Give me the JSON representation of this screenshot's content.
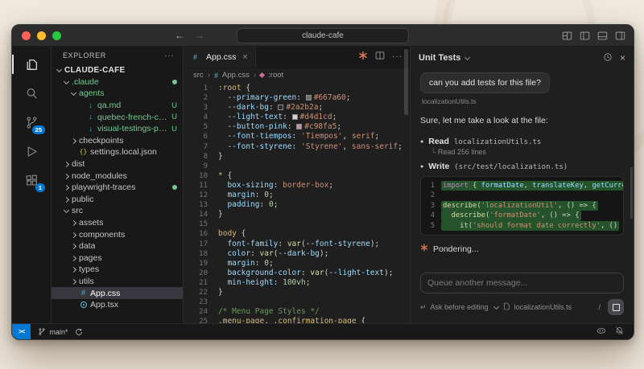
{
  "colors": {
    "badge_blue": "#0078d4",
    "git_green": "#73c991",
    "claude_orange": "#d97757",
    "remote_blue": "#0078d4",
    "diff_green": "rgba(63,185,80,0.38)"
  },
  "titlebar": {
    "search": "claude-cafe"
  },
  "activitybar": {
    "scm_badge": "25",
    "ext_badge": "1"
  },
  "explorer": {
    "title": "EXPLORER",
    "root": "CLAUDE-CAFE",
    "items": [
      {
        "label": ".claude",
        "depth": 1,
        "chev": "down",
        "dot": true,
        "color": "green"
      },
      {
        "label": "agents",
        "depth": 2,
        "chev": "down",
        "color": "green"
      },
      {
        "label": "qa.md",
        "depth": 3,
        "icon": "arrow",
        "git": "U",
        "color": "green"
      },
      {
        "label": "quebec-french-complian...",
        "depth": 3,
        "icon": "arrow",
        "git": "U",
        "color": "green"
      },
      {
        "label": "visual-testings-playwright...",
        "depth": 3,
        "icon": "arrow",
        "git": "U",
        "color": "green"
      },
      {
        "label": "checkpoints",
        "depth": 2,
        "chev": "right"
      },
      {
        "label": "settings.local.json",
        "depth": 2,
        "icon": "json"
      },
      {
        "label": "dist",
        "depth": 1,
        "chev": "right"
      },
      {
        "label": "node_modules",
        "depth": 1,
        "chev": "right"
      },
      {
        "label": "playwright-traces",
        "depth": 1,
        "chev": "right",
        "dot": true
      },
      {
        "label": "public",
        "depth": 1,
        "chev": "right"
      },
      {
        "label": "src",
        "depth": 1,
        "chev": "down"
      },
      {
        "label": "assets",
        "depth": 2,
        "chev": "right"
      },
      {
        "label": "components",
        "depth": 2,
        "chev": "right"
      },
      {
        "label": "data",
        "depth": 2,
        "chev": "right"
      },
      {
        "label": "pages",
        "depth": 2,
        "chev": "right"
      },
      {
        "label": "types",
        "depth": 2,
        "chev": "right"
      },
      {
        "label": "utils",
        "depth": 2,
        "chev": "right"
      },
      {
        "label": "App.css",
        "depth": 2,
        "icon": "css",
        "selected": true
      },
      {
        "label": "App.tsx",
        "depth": 2,
        "icon": "react"
      }
    ]
  },
  "editor": {
    "tab": "App.css",
    "breadcrumbs": [
      "src",
      "App.css",
      ":root"
    ],
    "lines": [
      [
        [
          "sel",
          ":root"
        ],
        [
          "p",
          " {"
        ]
      ],
      [
        [
          "p",
          "  "
        ],
        [
          "prop",
          "--primary-green"
        ],
        [
          "p",
          ": "
        ],
        [
          "sw",
          "#667a60"
        ],
        [
          "val",
          "#667a60"
        ],
        [
          "p",
          ";"
        ]
      ],
      [
        [
          "p",
          "  "
        ],
        [
          "prop",
          "--dark-bg"
        ],
        [
          "p",
          ": "
        ],
        [
          "sw",
          "#2a2b2a"
        ],
        [
          "val",
          "#2a2b2a"
        ],
        [
          "p",
          ";"
        ]
      ],
      [
        [
          "p",
          "  "
        ],
        [
          "prop",
          "--light-text"
        ],
        [
          "p",
          ": "
        ],
        [
          "sw",
          "#d4d1cd"
        ],
        [
          "val",
          "#d4d1cd"
        ],
        [
          "p",
          ";"
        ]
      ],
      [
        [
          "p",
          "  "
        ],
        [
          "prop",
          "--button-pink"
        ],
        [
          "p",
          ": "
        ],
        [
          "sw",
          "#c98fa5"
        ],
        [
          "val",
          "#c98fa5"
        ],
        [
          "p",
          ";"
        ]
      ],
      [
        [
          "p",
          "  "
        ],
        [
          "prop",
          "--font-tiempos"
        ],
        [
          "p",
          ": "
        ],
        [
          "str",
          "'Tiempos'"
        ],
        [
          "p",
          ", "
        ],
        [
          "val",
          "serif"
        ],
        [
          "p",
          ";"
        ]
      ],
      [
        [
          "p",
          "  "
        ],
        [
          "prop",
          "--font-styrene"
        ],
        [
          "p",
          ": "
        ],
        [
          "str",
          "'Styrene'"
        ],
        [
          "p",
          ", "
        ],
        [
          "val",
          "sans-serif"
        ],
        [
          "p",
          ";"
        ]
      ],
      [
        [
          "p",
          "}"
        ]
      ],
      [],
      [
        [
          "sel",
          "*"
        ],
        [
          "p",
          " {"
        ]
      ],
      [
        [
          "p",
          "  "
        ],
        [
          "prop",
          "box-sizing"
        ],
        [
          "p",
          ": "
        ],
        [
          "val",
          "border-box"
        ],
        [
          "p",
          ";"
        ]
      ],
      [
        [
          "p",
          "  "
        ],
        [
          "prop",
          "margin"
        ],
        [
          "p",
          ": "
        ],
        [
          "num",
          "0"
        ],
        [
          "p",
          ";"
        ]
      ],
      [
        [
          "p",
          "  "
        ],
        [
          "prop",
          "padding"
        ],
        [
          "p",
          ": "
        ],
        [
          "num",
          "0"
        ],
        [
          "p",
          ";"
        ]
      ],
      [
        [
          "p",
          "}"
        ]
      ],
      [],
      [
        [
          "sel",
          "body"
        ],
        [
          "p",
          " {"
        ]
      ],
      [
        [
          "p",
          "  "
        ],
        [
          "prop",
          "font-family"
        ],
        [
          "p",
          ": "
        ],
        [
          "fn",
          "var"
        ],
        [
          "p",
          "("
        ],
        [
          "prop",
          "--font-styrene"
        ],
        [
          "p",
          ");"
        ]
      ],
      [
        [
          "p",
          "  "
        ],
        [
          "prop",
          "color"
        ],
        [
          "p",
          ": "
        ],
        [
          "fn",
          "var"
        ],
        [
          "p",
          "("
        ],
        [
          "prop",
          "--dark-bg"
        ],
        [
          "p",
          ");"
        ]
      ],
      [
        [
          "p",
          "  "
        ],
        [
          "prop",
          "margin"
        ],
        [
          "p",
          ": "
        ],
        [
          "num",
          "0"
        ],
        [
          "p",
          ";"
        ]
      ],
      [
        [
          "p",
          "  "
        ],
        [
          "prop",
          "background-color"
        ],
        [
          "p",
          ": "
        ],
        [
          "fn",
          "var"
        ],
        [
          "p",
          "("
        ],
        [
          "prop",
          "--light-text"
        ],
        [
          "p",
          ");"
        ]
      ],
      [
        [
          "p",
          "  "
        ],
        [
          "prop",
          "min-height"
        ],
        [
          "p",
          ": "
        ],
        [
          "num",
          "100vh"
        ],
        [
          "p",
          ";"
        ]
      ],
      [
        [
          "p",
          "}"
        ]
      ],
      [],
      [
        [
          "com",
          "/* Menu Page Styles */"
        ]
      ],
      [
        [
          "sel",
          ".menu-page"
        ],
        [
          "p",
          ", "
        ],
        [
          "sel",
          ".confirmation-page"
        ],
        [
          "p",
          " {"
        ]
      ]
    ]
  },
  "chat": {
    "title": "Unit Tests",
    "user_message": "can you add tests for this file?",
    "attachment": "localizationUtils.ts",
    "intro": "Sure, let me take a look at the file:",
    "read_label": "Read",
    "read_file": "localizationUtils.ts",
    "read_detail": "Read 256 lines",
    "write_label": "Write",
    "write_file": "(src/test/localization.ts)",
    "status": "Pondering...",
    "code_lines": [
      {
        "hl": true,
        "t": [
          [
            "kw",
            "import"
          ],
          [
            "p",
            " { "
          ],
          [
            "id",
            "formatDate"
          ],
          [
            "p",
            ", "
          ],
          [
            "id",
            "translateKey"
          ],
          [
            "p",
            ", "
          ],
          [
            "id",
            "getCurrencyS"
          ]
        ]
      },
      {
        "hl": false,
        "t": []
      },
      {
        "hl": true,
        "t": [
          [
            "fn",
            "describe"
          ],
          [
            "p",
            "("
          ],
          [
            "str",
            "'localizationUtil'"
          ],
          [
            "p",
            ", () => {"
          ]
        ]
      },
      {
        "hl": true,
        "t": [
          [
            "p",
            "  "
          ],
          [
            "fn",
            "describe"
          ],
          [
            "p",
            "("
          ],
          [
            "str",
            "'formatDate'"
          ],
          [
            "p",
            ", () => {"
          ]
        ]
      },
      {
        "hl": true,
        "t": [
          [
            "p",
            "    "
          ],
          [
            "fn",
            "it"
          ],
          [
            "p",
            "("
          ],
          [
            "str",
            "'should format date correctly'"
          ],
          [
            "p",
            ", ()"
          ]
        ]
      }
    ],
    "composer": {
      "placeholder": "Queue another message...",
      "mode": "Ask before editing",
      "file": "localizationUtils.ts",
      "shortcut": "/"
    }
  },
  "statusbar": {
    "remote": "><",
    "branch": "main*"
  }
}
